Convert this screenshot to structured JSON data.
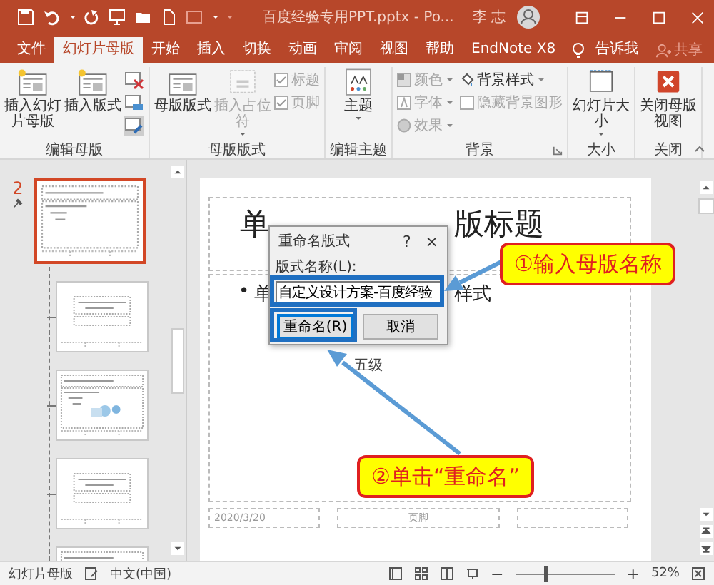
{
  "title_bar": {
    "title": "百度经验专用PPT.pptx  -  Po...",
    "user": "李 志"
  },
  "tabs": [
    {
      "label": "文件",
      "selected": false
    },
    {
      "label": "幻灯片母版",
      "selected": true
    },
    {
      "label": "开始",
      "selected": false
    },
    {
      "label": "插入",
      "selected": false
    },
    {
      "label": "切换",
      "selected": false
    },
    {
      "label": "动画",
      "selected": false
    },
    {
      "label": "审阅",
      "selected": false
    },
    {
      "label": "视图",
      "selected": false
    },
    {
      "label": "帮助",
      "selected": false
    },
    {
      "label": "EndNote X8",
      "selected": false
    }
  ],
  "tell_me": "告诉我",
  "share": "共享",
  "ribbon": [
    {
      "label": "编辑母版",
      "launcher": false,
      "items": [
        {
          "kind": "master",
          "label": "插入幻灯片母版",
          "disabled": false,
          "dropdown": false
        },
        {
          "kind": "layout",
          "label": "插入版式",
          "disabled": false,
          "dropdown": false
        },
        {
          "kind": "tools"
        }
      ]
    },
    {
      "label": "母版版式",
      "launcher": false,
      "items": [
        {
          "kind": "layout",
          "label": "母版版式",
          "disabled": false,
          "dropdown": false
        },
        {
          "kind": "placeholder",
          "label": "插入占位符",
          "disabled": true,
          "dropdown": true
        },
        {
          "kind": "check",
          "label": "标题",
          "checked": true,
          "disabled": true
        },
        {
          "kind": "check",
          "label": "页脚",
          "checked": true,
          "disabled": true
        }
      ]
    },
    {
      "label": "编辑主题",
      "launcher": false,
      "items": [
        {
          "kind": "theme",
          "label": "主题",
          "disabled": false,
          "dropdown": true
        }
      ]
    },
    {
      "label": "背景",
      "launcher": true,
      "items": [
        {
          "kind": "colors",
          "label": "颜色",
          "disabled": true,
          "dropdown": true
        },
        {
          "kind": "fonts",
          "label": "字体",
          "disabled": true,
          "dropdown": true
        },
        {
          "kind": "effects",
          "label": "效果",
          "disabled": true,
          "dropdown": true
        },
        {
          "kind": "style",
          "label": "背景样式",
          "disabled": false,
          "dropdown": true
        },
        {
          "kind": "check",
          "label": "隐藏背景图形",
          "checked": false,
          "disabled": true
        }
      ]
    },
    {
      "label": "大小",
      "launcher": false,
      "items": [
        {
          "kind": "size",
          "label": "幻灯片大小",
          "disabled": false,
          "dropdown": true
        }
      ]
    },
    {
      "label": "关闭",
      "launcher": false,
      "items": [
        {
          "kind": "close",
          "label": "关闭母版视图",
          "disabled": false,
          "dropdown": false
        }
      ]
    }
  ],
  "thumbnails": [
    {
      "number": "2",
      "kind": "content",
      "selected": true
    },
    {
      "kind": "title",
      "selected": false
    },
    {
      "kind": "picture",
      "selected": false
    },
    {
      "kind": "title",
      "selected": false
    },
    {
      "kind": "content",
      "selected": false
    }
  ],
  "slide": {
    "title_parts": [
      "单",
      "版标题"
    ],
    "bullet": "•",
    "body_parts": [
      "单",
      "样式"
    ],
    "level5": "五级",
    "footers": [
      "2020/3/20",
      "页脚"
    ]
  },
  "dialog": {
    "title": "重命名版式",
    "help": "?",
    "close": "×",
    "field_label": "版式名称(L):",
    "value": "自定义设计方案-百度经验",
    "buttons": [
      {
        "label": "重命名(R)",
        "default": true
      },
      {
        "label": "取消",
        "default": false
      }
    ]
  },
  "callouts": [
    {
      "text": "①输入母版名称"
    },
    {
      "text": "②单击“重命名”"
    }
  ],
  "status_bar": {
    "view": "幻灯片母版",
    "language": "中文(中国)",
    "zoom_out": "−",
    "zoom_slider": {
      "level": 0.3
    },
    "zoom_in": "+",
    "zoom": "52%"
  }
}
